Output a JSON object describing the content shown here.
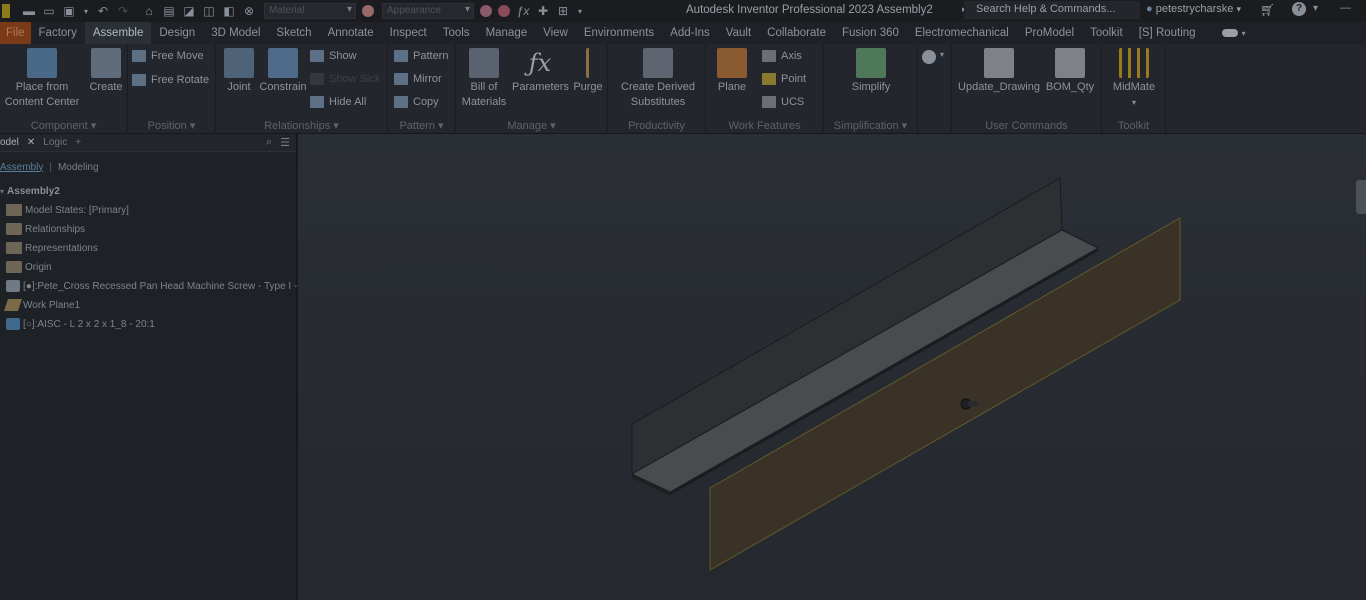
{
  "titlebar": {
    "app_title": "Autodesk Inventor Professional 2023    Assembly2",
    "material_placeholder": "Material",
    "appearance_placeholder": "Appearance",
    "search_label": "Search Help & Commands...",
    "user_name": "petestrycharske",
    "user_drop": "▾",
    "help_glyph": "?"
  },
  "tabs": [
    "File",
    "Factory",
    "Assemble",
    "Design",
    "3D Model",
    "Sketch",
    "Annotate",
    "Inspect",
    "Tools",
    "Manage",
    "View",
    "Environments",
    "Add-Ins",
    "Vault",
    "Collaborate",
    "Fusion 360",
    "Electromechanical",
    "ProModel",
    "Toolkit",
    "[S] Routing"
  ],
  "active_tab": "Assemble",
  "ribbon": {
    "component": {
      "label": "Component ▾",
      "place_line1": "Place from",
      "place_line2": "Content Center",
      "create": "Create"
    },
    "position": {
      "label": "Position ▾",
      "free_move": "Free Move",
      "free_rotate": "Free Rotate"
    },
    "relationships": {
      "label": "Relationships ▾",
      "joint": "Joint",
      "constrain": "Constrain",
      "show": "Show",
      "show_sick": "Show Sick",
      "hide_all": "Hide All"
    },
    "pattern": {
      "label": "Pattern ▾",
      "pattern": "Pattern",
      "mirror": "Mirror",
      "copy": "Copy"
    },
    "manage": {
      "label": "Manage ▾",
      "bom_line1": "Bill of",
      "bom_line2": "Materials",
      "parameters": "Parameters",
      "purge": "Purge"
    },
    "productivity": {
      "label": "Productivity",
      "derive_line1": "Create Derived",
      "derive_line2": "Substitutes"
    },
    "work_features": {
      "label": "Work Features",
      "plane": "Plane",
      "axis": "Axis",
      "point": "Point",
      "ucs": "UCS"
    },
    "simplification": {
      "label": "Simplification ▾",
      "simplify": "Simplify"
    },
    "user_commands": {
      "label": "User Commands",
      "update_drawing": "Update_Drawing",
      "bom_qty": "BOM_Qty"
    },
    "toolkit": {
      "label": "Toolkit",
      "midmate": "MidMate"
    }
  },
  "browser": {
    "tab_model": "odel",
    "tab_logic": "Logic",
    "tab_add": "+",
    "sub_assembly": "Assembly",
    "sub_modeling": "Modeling",
    "root": "Assembly2",
    "items": [
      "Model States: [Primary]",
      "Relationships",
      "Representations",
      "Origin",
      "[●]:Pete_Cross Recessed Pan Head Machine Screw - Type I - In",
      "Work Plane1",
      "[○]:AISC - L 2 x 2 x 1_8 - 20:1"
    ]
  },
  "colors": {
    "viewport_bg": "#262a30",
    "angle_top": "#2d2f33",
    "angle_face": "#4a4b4e",
    "workplane": "#3a3227",
    "workplane_edge": "#5e5a2a"
  }
}
